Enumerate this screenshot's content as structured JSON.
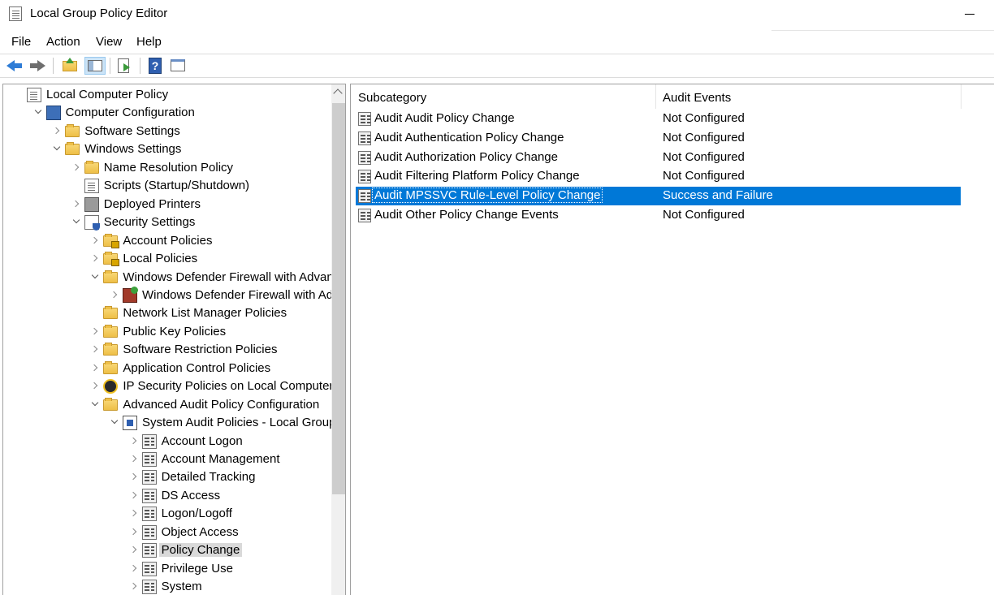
{
  "window": {
    "title": "Local Group Policy Editor"
  },
  "menu": [
    "File",
    "Action",
    "View",
    "Help"
  ],
  "toolbar": {
    "buttons": [
      "back-icon",
      "forward-icon",
      "up-folder-icon",
      "show-hide-tree-icon",
      "export-list-icon",
      "help-icon",
      "action-pane-icon"
    ]
  },
  "tree": {
    "items": [
      {
        "label": "Local Computer Policy",
        "icon": "policy-doc-icon",
        "expander": "none"
      },
      {
        "label": "Computer Configuration",
        "icon": "computer-icon",
        "expander": "open"
      },
      {
        "label": "Software Settings",
        "icon": "folder-icon",
        "expander": "closed"
      },
      {
        "label": "Windows Settings",
        "icon": "folder-icon",
        "expander": "open"
      },
      {
        "label": "Name Resolution Policy",
        "icon": "folder-icon",
        "expander": "closed"
      },
      {
        "label": "Scripts (Startup/Shutdown)",
        "icon": "script-icon",
        "expander": "none"
      },
      {
        "label": "Deployed Printers",
        "icon": "printer-icon",
        "expander": "closed"
      },
      {
        "label": "Security Settings",
        "icon": "security-icon",
        "expander": "open"
      },
      {
        "label": "Account Policies",
        "icon": "locked-folder-icon",
        "expander": "closed"
      },
      {
        "label": "Local Policies",
        "icon": "locked-folder-icon",
        "expander": "closed"
      },
      {
        "label": "Windows Defender Firewall with Advanced",
        "icon": "folder-icon",
        "expander": "open"
      },
      {
        "label": "Windows Defender Firewall with Advar",
        "icon": "firewall-icon",
        "expander": "closed"
      },
      {
        "label": "Network List Manager Policies",
        "icon": "folder-icon",
        "expander": "none"
      },
      {
        "label": "Public Key Policies",
        "icon": "folder-icon",
        "expander": "closed"
      },
      {
        "label": "Software Restriction Policies",
        "icon": "folder-icon",
        "expander": "closed"
      },
      {
        "label": "Application Control Policies",
        "icon": "folder-icon",
        "expander": "closed"
      },
      {
        "label": "IP Security Policies on Local Computer",
        "icon": "ipsec-icon",
        "expander": "closed"
      },
      {
        "label": "Advanced Audit Policy Configuration",
        "icon": "folder-icon",
        "expander": "open"
      },
      {
        "label": "System Audit Policies - Local Group Pol",
        "icon": "system-audit-icon",
        "expander": "open"
      },
      {
        "label": "Account Logon",
        "icon": "audit-category-icon",
        "expander": "closed"
      },
      {
        "label": "Account Management",
        "icon": "audit-category-icon",
        "expander": "closed"
      },
      {
        "label": "Detailed Tracking",
        "icon": "audit-category-icon",
        "expander": "closed"
      },
      {
        "label": "DS Access",
        "icon": "audit-category-icon",
        "expander": "closed"
      },
      {
        "label": "Logon/Logoff",
        "icon": "audit-category-icon",
        "expander": "closed"
      },
      {
        "label": "Object Access",
        "icon": "audit-category-icon",
        "expander": "closed"
      },
      {
        "label": "Policy Change",
        "icon": "audit-category-icon",
        "expander": "closed",
        "selected": true
      },
      {
        "label": "Privilege Use",
        "icon": "audit-category-icon",
        "expander": "closed"
      },
      {
        "label": "System",
        "icon": "audit-category-icon",
        "expander": "closed"
      }
    ]
  },
  "list": {
    "columns": [
      "Subcategory",
      "Audit Events"
    ],
    "rows": [
      {
        "name": "Audit Audit Policy Change",
        "value": "Not Configured"
      },
      {
        "name": "Audit Authentication Policy Change",
        "value": "Not Configured"
      },
      {
        "name": "Audit Authorization Policy Change",
        "value": "Not Configured"
      },
      {
        "name": "Audit Filtering Platform Policy Change",
        "value": "Not Configured"
      },
      {
        "name": "Audit MPSSVC Rule-Level Policy Change",
        "value": "Success and Failure",
        "selected": true
      },
      {
        "name": "Audit Other Policy Change Events",
        "value": "Not Configured"
      }
    ]
  },
  "colors": {
    "selection": "#0078d7",
    "tree_selection": "#d9d9d9"
  }
}
